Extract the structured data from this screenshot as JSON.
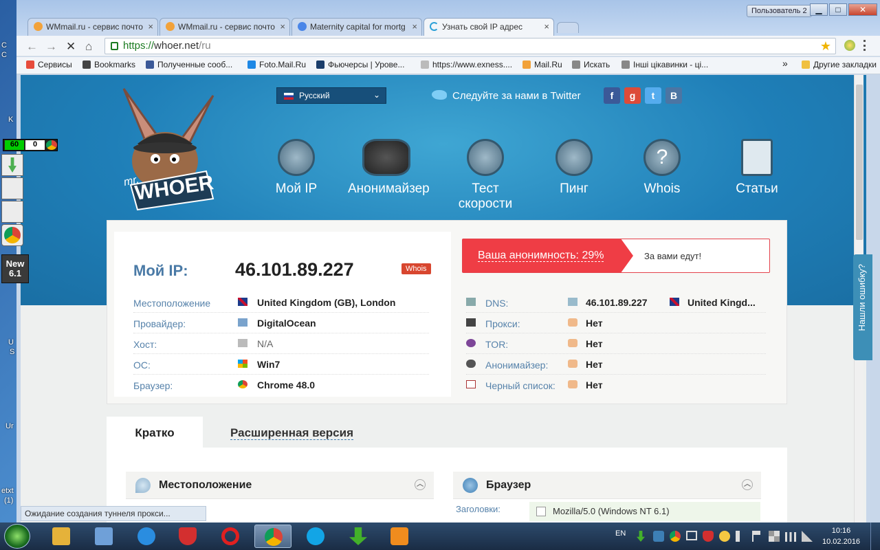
{
  "desktop": {
    "labels": [
      "C",
      "C",
      "K",
      "U",
      "S",
      "Ur",
      "etxt",
      "(1)"
    ]
  },
  "widget": {
    "count1": "60",
    "count2": "0",
    "new_label": "New",
    "new_version": "6.1"
  },
  "window": {
    "user_button": "Пользователь 2",
    "min": "▁",
    "max": "□",
    "close": "✕",
    "tabs": [
      {
        "title": "WMmail.ru - сервис почто",
        "color": "#f2a23a"
      },
      {
        "title": "WMmail.ru - сервис почто",
        "color": "#f2a23a"
      },
      {
        "title": "Maternity capital for mortg",
        "color": "#4a86e8"
      },
      {
        "title": "Узнать свой IP адрес",
        "color": "#ffffff"
      }
    ]
  },
  "toolbar": {
    "back": "←",
    "forward": "→",
    "stop": "✕",
    "home": "⌂",
    "url_scheme": "https://",
    "url_host": "whoer.net",
    "url_path": "/ru",
    "star": "★"
  },
  "bookmarks": {
    "items": [
      {
        "label": "Сервисы",
        "color": "#e74c3c"
      },
      {
        "label": "Bookmarks",
        "color": "#444444"
      },
      {
        "label": "Полученные сооб...",
        "color": "#3b5998"
      },
      {
        "label": "Foto.Mail.Ru",
        "color": "#1e88e5"
      },
      {
        "label": "Фьючерсы | Урове...",
        "color": "#1a3d6b"
      },
      {
        "label": "https://www.exness....",
        "color": "#bbbbbb"
      },
      {
        "label": "Mail.Ru",
        "color": "#f2a23a"
      },
      {
        "label": "Искать",
        "color": "#888888"
      },
      {
        "label": "Інші цікавинки - ці...",
        "color": "#888888"
      }
    ],
    "more": "»",
    "other": "Другие закладки"
  },
  "site": {
    "language": "Русский",
    "twitter": "Следуйте за нами в Twitter",
    "social": [
      {
        "letter": "f",
        "color": "#3b5998"
      },
      {
        "letter": "g",
        "color": "#dd4b39"
      },
      {
        "letter": "t",
        "color": "#55acee"
      },
      {
        "letter": "B",
        "color": "#4c75a3"
      }
    ],
    "logo_mr": "mr.",
    "logo_main": "WHOER",
    "nav": [
      "Мой IP",
      "Анонимайзер",
      "Тест скорости",
      "Пинг",
      "Whois",
      "Статьи"
    ]
  },
  "ipcard": {
    "label": "Мой IP:",
    "ip": "46.101.89.227",
    "whois": "Whois",
    "rows": [
      {
        "key": "Местоположение",
        "value": "United Kingdom (GB), London",
        "icon": "uk-flag"
      },
      {
        "key": "Провайдер:",
        "value": "DigitalOcean",
        "icon": "provider"
      },
      {
        "key": "Хост:",
        "value": "N/A",
        "icon": "host"
      },
      {
        "key": "ОС:",
        "value": "Win7",
        "icon": "windows"
      },
      {
        "key": "Браузер:",
        "value": "Chrome 48.0",
        "icon": "chrome"
      }
    ],
    "anon_label": "Ваша анонимность: 29%",
    "anon_msg": "За вами едут!",
    "right_rows": [
      {
        "key": "DNS:",
        "value": "46.101.89.227",
        "extra": "United Kingd..."
      },
      {
        "key": "Прокси:",
        "value": "Нет"
      },
      {
        "key": "TOR:",
        "value": "Нет"
      },
      {
        "key": "Анонимайзер:",
        "value": "Нет"
      },
      {
        "key": "Черный список:",
        "value": "Нет"
      }
    ]
  },
  "tabs": {
    "brief": "Кратко",
    "extended": "Расширенная версия"
  },
  "panel": {
    "location_title": "Местоположение",
    "browser_title": "Браузер",
    "headers_key": "Заголовки:",
    "headers_value": "Mozilla/5.0 (Windows NT 6.1)"
  },
  "feedback": "Нашли ошибку?",
  "status": "Ожидание создания туннеля прокси...",
  "taskbar": {
    "lang": "EN",
    "time": "10:16",
    "date": "10.02.2016",
    "apps": [
      {
        "name": "explorer",
        "color": "#e5b23a"
      },
      {
        "name": "control",
        "color": "#6fa0d8"
      },
      {
        "name": "ie",
        "color": "#2a8de0"
      },
      {
        "name": "shield",
        "color": "#d32f2f"
      },
      {
        "name": "opera",
        "color": "#e02020"
      },
      {
        "name": "chrome",
        "color": "#3a9d3a"
      },
      {
        "name": "skype",
        "color": "#12a5e6"
      },
      {
        "name": "download",
        "color": "#43b02a"
      },
      {
        "name": "media",
        "color": "#f08c1e"
      }
    ]
  }
}
